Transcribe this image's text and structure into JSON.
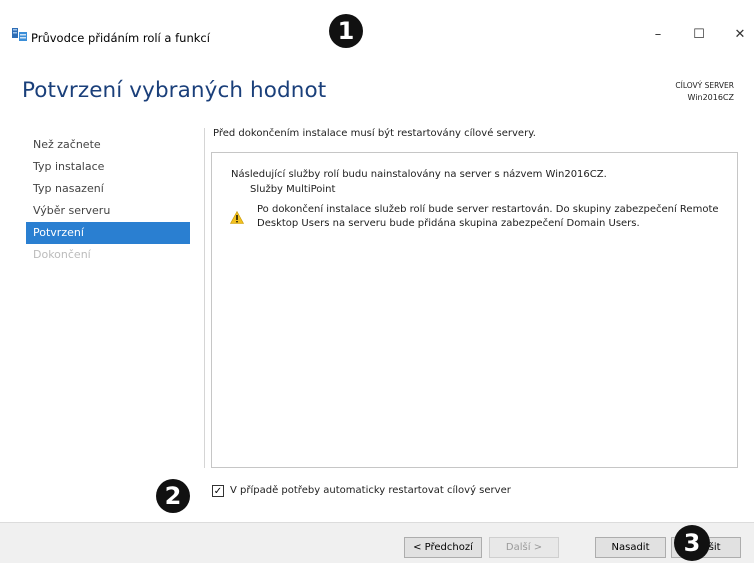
{
  "window": {
    "title": "Průvodce přidáním rolí a funkcí",
    "minimize_glyph": "–",
    "maximize_glyph": "☐",
    "close_glyph": "✕"
  },
  "header": {
    "page_title": "Potvrzení vybraných hodnot",
    "target_server_label": "CÍLOVÝ SERVER",
    "target_server_name": "Win2016CZ"
  },
  "nav": {
    "items": [
      {
        "label": "Než začnete",
        "state": "normal"
      },
      {
        "label": "Typ instalace",
        "state": "normal"
      },
      {
        "label": "Typ nasazení",
        "state": "normal"
      },
      {
        "label": "Výběr serveru",
        "state": "normal"
      },
      {
        "label": "Potvrzení",
        "state": "active"
      },
      {
        "label": "Dokončení",
        "state": "disabled"
      }
    ]
  },
  "content": {
    "intro": "Před dokončením instalace musí být restartovány cílové servery.",
    "panel": {
      "line1": "Následující služby rolí budu nainstalovány na server s názvem Win2016CZ.",
      "line2": "Služby MultiPoint",
      "warning": "Po dokončení instalace služeb rolí bude server restartován. Do skupiny zabezpečení Remote Desktop Users na serveru bude přidána skupina zabezpečení Domain Users."
    },
    "restart_checkbox": {
      "label": "V případě potřeby automaticky restartovat cílový server",
      "checked": true,
      "check_glyph": "✓"
    }
  },
  "footer": {
    "prev_label": "< Předchozí",
    "next_label": "Další >",
    "install_label": "Nasadit",
    "cancel_label": "Zrušit"
  },
  "annotations": {
    "badge1": "1",
    "badge2": "2",
    "badge3": "3"
  },
  "colors": {
    "title_blue": "#1a3f7a",
    "nav_active": "#2a7fd1",
    "warning_yellow": "#f2c01e"
  }
}
